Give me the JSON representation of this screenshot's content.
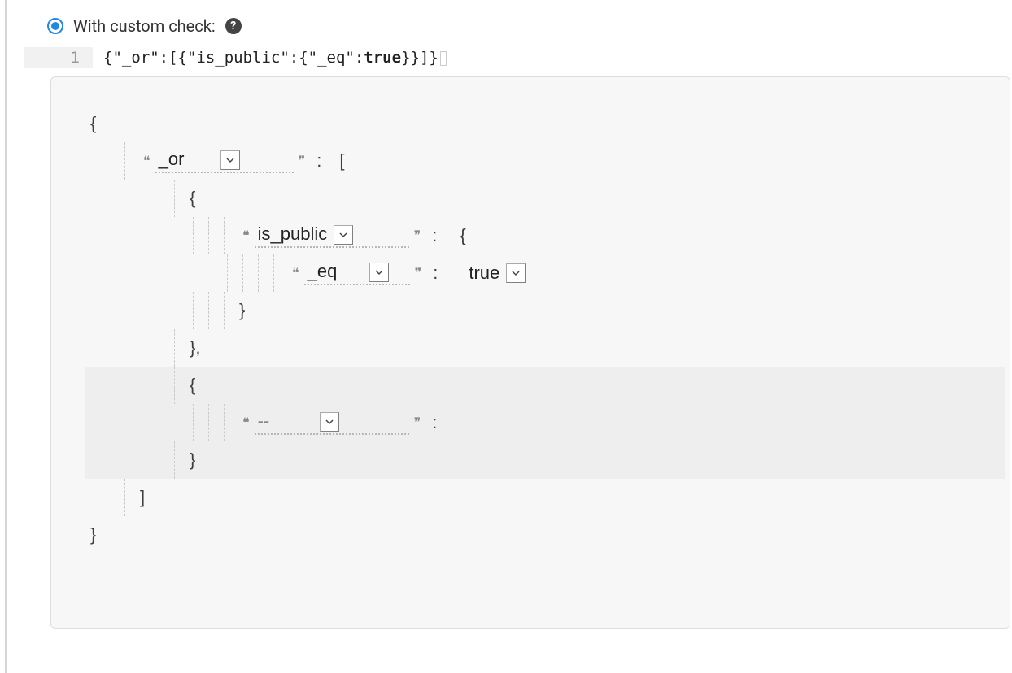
{
  "radio": {
    "label": "With custom check:"
  },
  "gutter": "1",
  "code": {
    "p1": "{\"_or\":[{\"is_public\":{\"_eq\":",
    "kw": "true",
    "p2": "}}]}"
  },
  "builder": {
    "open": "{",
    "close": "}",
    "open_arr": "[",
    "close_arr": "]",
    "comma": ",",
    "colon": ":",
    "field_or": "_or",
    "field_ispublic": "is_public",
    "field_eq": "_eq",
    "field_empty": "--",
    "value_true": "true"
  }
}
